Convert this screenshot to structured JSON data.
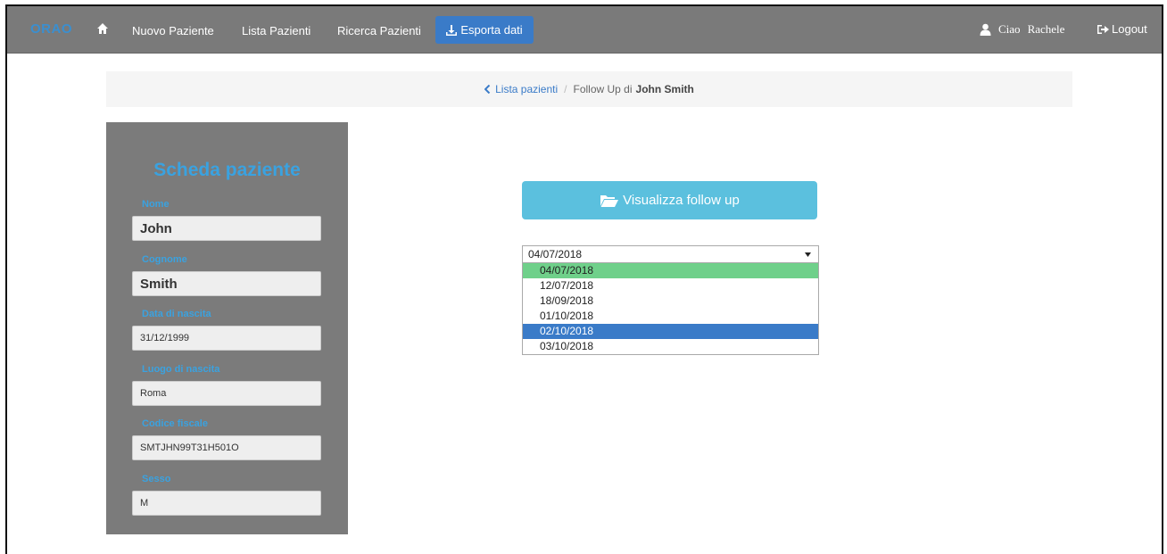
{
  "navbar": {
    "brand": "ORAO",
    "links": [
      "Nuovo Paziente",
      "Lista Pazienti",
      "Ricerca Pazienti"
    ],
    "export_label": "Esporta dati",
    "greeting": "Ciao",
    "user_name": "Rachele",
    "logout_label": "Logout",
    "icons": [
      "home-icon",
      "download-icon",
      "user-icon",
      "logout-icon"
    ]
  },
  "breadcrumb": {
    "back_label": "Lista pazienti",
    "separator": "/",
    "current_prefix": "Follow Up di",
    "current_name": "John Smith"
  },
  "patient_card": {
    "title": "Scheda paziente",
    "fields": [
      {
        "label": "Nome",
        "value": "John"
      },
      {
        "label": "Cognome",
        "value": "Smith"
      },
      {
        "label": "Data di nascita",
        "value": "31/12/1999"
      },
      {
        "label": "Luogo di nascita",
        "value": "Roma"
      },
      {
        "label": "Codice fiscale",
        "value": "SMTJHN99T31H501O"
      },
      {
        "label": "Sesso",
        "value": "M"
      }
    ]
  },
  "follow_up": {
    "button_label": "Visualizza follow up",
    "selected_date": "04/07/2018",
    "options": [
      "04/07/2018",
      "12/07/2018",
      "18/09/2018",
      "01/10/2018",
      "02/10/2018",
      "03/10/2018"
    ],
    "hovered_option": "02/10/2018"
  },
  "colors": {
    "navbar_bg": "#7a7a7a",
    "accent_blue": "#3a7bc8",
    "label_blue": "#3aa2e0",
    "button_cyan": "#5bc0de",
    "selected_green": "#6fd08a",
    "sidebar_bg": "#7b7b7b"
  }
}
